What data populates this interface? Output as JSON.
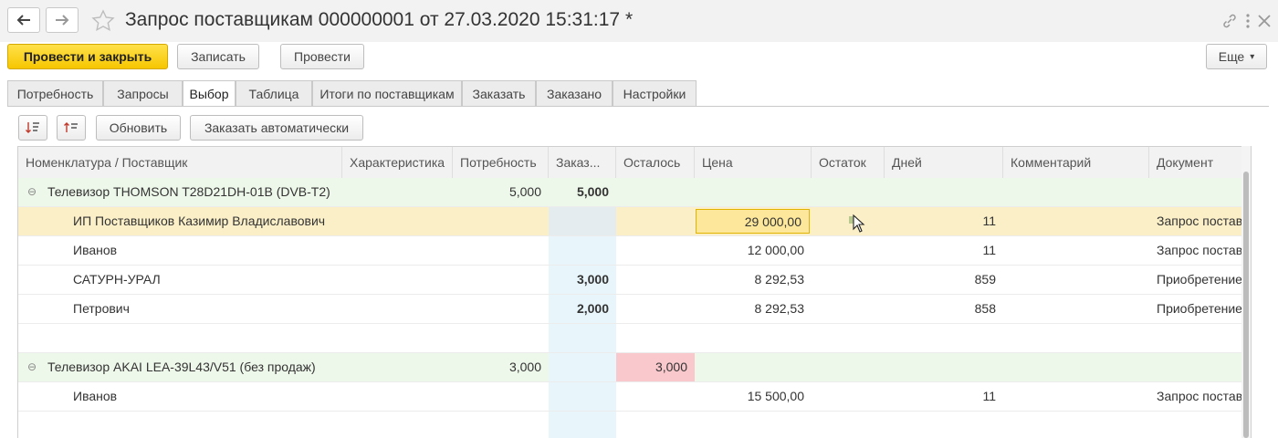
{
  "window": {
    "title": "Запрос поставщикам 000000001 от 27.03.2020 15:31:17 *",
    "icons": [
      "back-arrow-icon",
      "forward-arrow-icon",
      "star-icon",
      "link-icon",
      "more-vertical-icon",
      "close-icon"
    ]
  },
  "toolbar": {
    "post_and_close": "Провести и закрыть",
    "save": "Записать",
    "post": "Провести",
    "more": "Еще",
    "more_arrow": "▾"
  },
  "tabs": [
    "Потребность",
    "Запросы",
    "Выбор",
    "Таблица",
    "Итоги по поставщикам",
    "Заказать",
    "Заказано",
    "Настройки"
  ],
  "active_tab": "Выбор",
  "grid_toolbar": {
    "refresh": "Обновить",
    "order_auto": "Заказать автоматически"
  },
  "table": {
    "columns": [
      "Номенклатура / Поставщик",
      "Характеристика",
      "Потребность",
      "Заказ...",
      "Осталось",
      "Цена",
      "Остаток",
      "Дней",
      "Комментарий",
      "Документ"
    ],
    "rows": [
      {
        "type": "group",
        "expander": "⊖",
        "name": "Телевизор THOMSON T28D21DH-01B (DVB-T2)",
        "need": "5,000",
        "order": "5,000",
        "left": "",
        "price": "",
        "days": "",
        "doc": ""
      },
      {
        "type": "supplier",
        "name": "ИП Поставщиков Казимир Владиславович",
        "need": "",
        "order": "",
        "left": "",
        "price": "29 000,00",
        "days": "11",
        "doc": "Запрос постав"
      },
      {
        "type": "supplier",
        "name": "Иванов",
        "need": "",
        "order": "",
        "left": "",
        "price": "12 000,00",
        "days": "11",
        "doc": "Запрос постав"
      },
      {
        "type": "supplier",
        "name": "САТУРН-УРАЛ",
        "need": "",
        "order": "3,000",
        "left": "",
        "price": "8 292,53",
        "days": "859",
        "doc": "Приобретение"
      },
      {
        "type": "supplier",
        "name": "Петрович",
        "need": "",
        "order": "2,000",
        "left": "",
        "price": "8 292,53",
        "days": "858",
        "doc": "Приобретение"
      },
      {
        "type": "empty",
        "name": "",
        "need": "",
        "order": "",
        "left": "",
        "price": "",
        "days": "",
        "doc": ""
      },
      {
        "type": "group",
        "expander": "⊖",
        "name": "Телевизор AKAI LEA-39L43/V51 (без продаж)",
        "need": "3,000",
        "order": "",
        "left": "3,000",
        "price": "",
        "days": "",
        "doc": ""
      },
      {
        "type": "supplier",
        "name": "Иванов",
        "need": "",
        "order": "",
        "left": "",
        "price": "15 500,00",
        "days": "11",
        "doc": "Запрос постав"
      }
    ]
  },
  "colors": {
    "accent_yellow": "#f6c600",
    "group_row_bg": "#eef8ea",
    "selected_row_bg": "#fbefc8",
    "order_column_bg": "#e8f6fc",
    "remaining_red": "#f9c8cc"
  }
}
